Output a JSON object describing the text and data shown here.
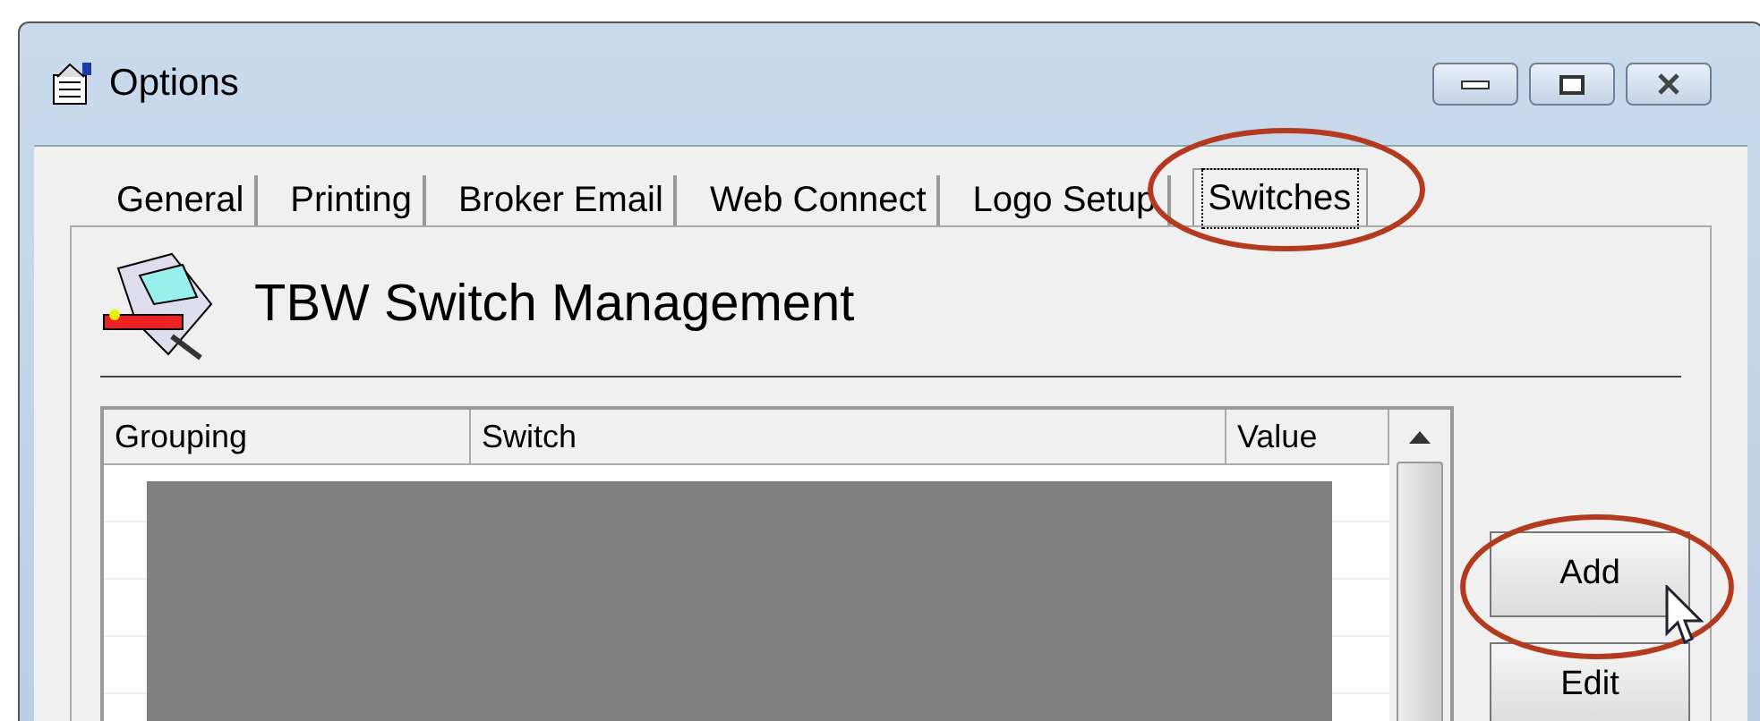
{
  "window": {
    "title": "Options"
  },
  "tabs": [
    {
      "label": "General",
      "selected": false
    },
    {
      "label": "Printing",
      "selected": false
    },
    {
      "label": "Broker Email",
      "selected": false
    },
    {
      "label": "Web Connect",
      "selected": false
    },
    {
      "label": "Logo Setup",
      "selected": false
    },
    {
      "label": "Switches",
      "selected": true
    }
  ],
  "heading": "TBW Switch Management",
  "table": {
    "columns": [
      "Grouping",
      "Switch",
      "Value"
    ]
  },
  "buttons": [
    "Add",
    "Edit"
  ]
}
